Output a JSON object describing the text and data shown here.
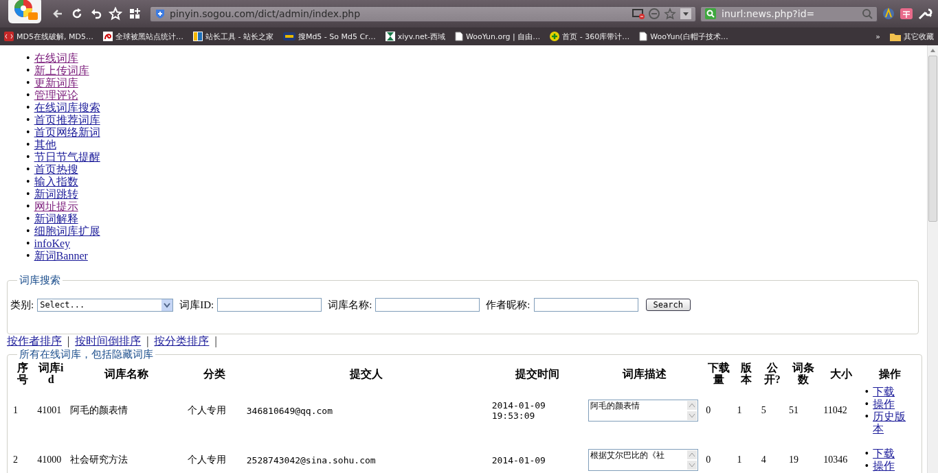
{
  "browser": {
    "address": "pinyin.sogou.com/dict/admin/index.php",
    "search_query": "inurl:news.php?id=",
    "bookmarks": [
      {
        "label": "MD5在线破解, MD5…"
      },
      {
        "label": "全球被黑站点统计…"
      },
      {
        "label": "站长工具 - 站长之家"
      },
      {
        "label": "搜Md5 - So Md5 Cr…"
      },
      {
        "label": "xiyv.net-西域"
      },
      {
        "label": "WooYun.org | 自由…"
      },
      {
        "label": "首页 - 360库带计…"
      },
      {
        "label": "WooYun(白帽子技术…"
      }
    ],
    "overflow": "»",
    "other_bookmarks": "其它收藏"
  },
  "nav_links": [
    {
      "bullet": "•",
      "label": "在线词库",
      "visited": true
    },
    {
      "bullet": "•",
      "label": "新上传词库",
      "visited": true
    },
    {
      "bullet": "•",
      "label": "更新词库",
      "visited": true
    },
    {
      "bullet": "•",
      "label": "管理评论",
      "visited": true
    },
    {
      "bullet": "•",
      "label": "在线词库搜索",
      "visited": false
    },
    {
      "bullet": "•",
      "label": "首页推荐词库",
      "visited": false
    },
    {
      "bullet": "•",
      "label": "首页网络新词",
      "visited": false
    },
    {
      "bullet": "•",
      "label": "其他",
      "visited": false
    },
    {
      "bullet": "•",
      "label": "节日节气提醒",
      "visited": false
    },
    {
      "bullet": "•",
      "label": "首页热搜",
      "visited": false
    },
    {
      "bullet": "•",
      "label": "输入指数",
      "visited": false
    },
    {
      "bullet": "•",
      "label": "新词跳转",
      "visited": false
    },
    {
      "bullet": "•",
      "label": "网址提示",
      "visited": true
    },
    {
      "bullet": "•",
      "label": "新词解释",
      "visited": false
    },
    {
      "bullet": "•",
      "label": "细胞词库扩展",
      "visited": false
    },
    {
      "bullet": "•",
      "label": "infoKey",
      "visited": false
    },
    {
      "bullet": "•",
      "label": "新词Banner",
      "visited": false
    }
  ],
  "search_panel": {
    "legend": "词库搜索",
    "category_label": "类别:",
    "category_value": "Select...",
    "id_label": "词库ID:",
    "name_label": "词库名称:",
    "author_label": "作者昵称:",
    "button": "Search"
  },
  "sort_links": [
    {
      "label": "按作者排序",
      "separator": "|"
    },
    {
      "label": "按时间倒排序",
      "separator": "|"
    },
    {
      "label": "按分类排序",
      "separator": "|"
    }
  ],
  "table": {
    "legend": "所有在线词库，包括隐藏词库",
    "columns": [
      "序号",
      "词库id",
      "词库名称",
      "分类",
      "提交人",
      "提交时间",
      "词库描述",
      "下载量",
      "版本",
      "公开?",
      "词条数",
      "大小",
      "操作"
    ],
    "rows": [
      {
        "no": "1",
        "id": "41001",
        "name": "阿毛的颜表情",
        "category": "个人专用",
        "submitter": "346810649@qq.com",
        "date": "2014-01-09",
        "time": "19:53:09",
        "description": "阿毛的颜表情",
        "downloads": "0",
        "version": "1",
        "public": "5",
        "entries": "51",
        "size": "11042",
        "actions": [
          {
            "bullet": "•",
            "label": "下载"
          },
          {
            "bullet": "•",
            "label": "操作"
          },
          {
            "bullet": "•",
            "label": "历史版本"
          }
        ]
      },
      {
        "no": "2",
        "id": "41000",
        "name": "社会研究方法",
        "category": "个人专用",
        "submitter": "2528743042@sina.sohu.com",
        "date": "2014-01-09",
        "time": "",
        "description": "根据艾尔巴比的《社",
        "downloads": "0",
        "version": "1",
        "public": "4",
        "entries": "19",
        "size": "10346",
        "actions": [
          {
            "bullet": "•",
            "label": "下载"
          },
          {
            "bullet": "•",
            "label": "操作"
          }
        ]
      }
    ]
  }
}
